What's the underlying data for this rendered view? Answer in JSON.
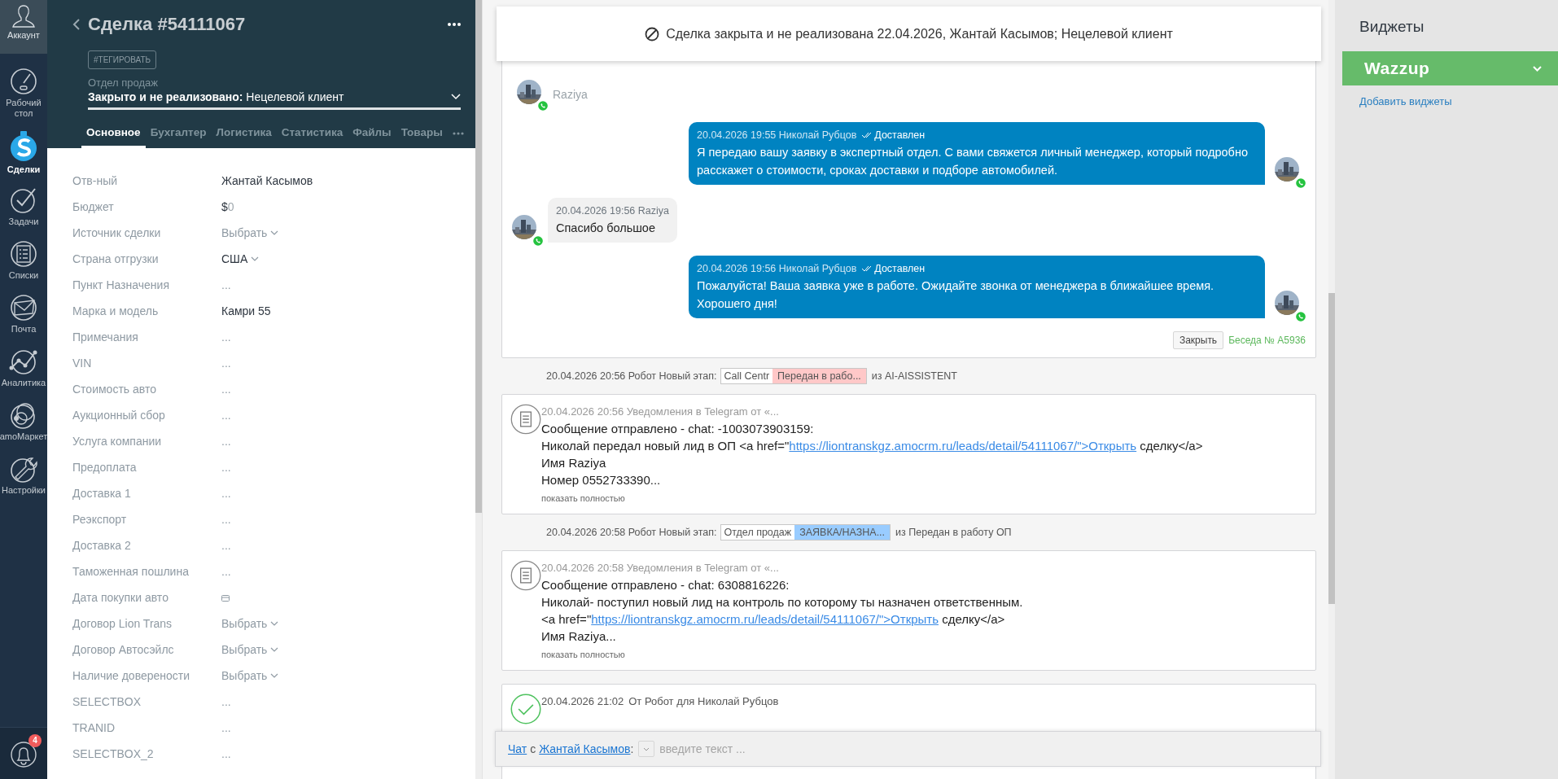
{
  "nav": {
    "account": "Аккаунт",
    "items": [
      {
        "label": "Рабочий стол",
        "kind": "dashboard",
        "selected": false
      },
      {
        "label": "Сделки",
        "kind": "deals",
        "selected": true
      },
      {
        "label": "Задачи",
        "kind": "tasks",
        "selected": false
      },
      {
        "label": "Списки",
        "kind": "lists",
        "selected": false
      },
      {
        "label": "Почта",
        "kind": "mail",
        "selected": false
      },
      {
        "label": "Аналитика",
        "kind": "analytics",
        "selected": false
      },
      {
        "label": "amoМаркет",
        "kind": "market",
        "selected": false
      },
      {
        "label": "Настройки",
        "kind": "settings",
        "selected": false
      }
    ],
    "notifications_badge": "4"
  },
  "lead": {
    "title": "Сделка #54111067",
    "tag_button": "#ТЕГИРОВАТЬ",
    "pipeline": "Отдел продаж",
    "status_bold": "Закрыто и не реализовано:",
    "status": "Нецелевой клиент",
    "tabs": [
      {
        "label": "Основное",
        "selected": true
      },
      {
        "label": "Бухгалтер",
        "selected": false
      },
      {
        "label": "Логистика",
        "selected": false
      },
      {
        "label": "Статистика",
        "selected": false
      },
      {
        "label": "Файлы",
        "selected": false
      },
      {
        "label": "Товары",
        "selected": false
      }
    ],
    "fields": [
      {
        "label": "Отв-ный",
        "kind": "text",
        "value": "Жантай Касымов"
      },
      {
        "label": "Бюджет",
        "kind": "money",
        "currency": "$",
        "value": "0"
      },
      {
        "label": "Источник сделки",
        "kind": "select",
        "placeholder": "Выбрать"
      },
      {
        "label": "Страна отгрузки",
        "kind": "select_filled",
        "value": "США"
      },
      {
        "label": "Пункт Назначения",
        "kind": "empty",
        "placeholder": "..."
      },
      {
        "label": "Марка и модель",
        "kind": "text",
        "value": "Камри 55"
      },
      {
        "label": "Примечания",
        "kind": "empty",
        "placeholder": "..."
      },
      {
        "label": "VIN",
        "kind": "empty",
        "placeholder": "..."
      },
      {
        "label": "Стоимость авто",
        "kind": "empty",
        "placeholder": "..."
      },
      {
        "label": "Аукционный сбор",
        "kind": "empty",
        "placeholder": "..."
      },
      {
        "label": "Услуга компании",
        "kind": "empty",
        "placeholder": "..."
      },
      {
        "label": "Предоплата",
        "kind": "empty",
        "placeholder": "..."
      },
      {
        "label": "Доставка 1",
        "kind": "empty",
        "placeholder": "..."
      },
      {
        "label": "Реэкспорт",
        "kind": "empty",
        "placeholder": "..."
      },
      {
        "label": "Доставка 2",
        "kind": "empty",
        "placeholder": "..."
      },
      {
        "label": "Таможенная пошлина",
        "kind": "empty",
        "placeholder": "..."
      },
      {
        "label": "Дата покупки авто",
        "kind": "date"
      },
      {
        "label": "Договор Lion Trans",
        "kind": "select",
        "placeholder": "Выбрать"
      },
      {
        "label": "Договор Автосэйлс",
        "kind": "select",
        "placeholder": "Выбрать"
      },
      {
        "label": "Наличие доверености",
        "kind": "select",
        "placeholder": "Выбрать"
      },
      {
        "label": "SELECTBOX",
        "kind": "empty",
        "placeholder": "..."
      },
      {
        "label": "TRANID",
        "kind": "empty",
        "placeholder": "..."
      },
      {
        "label": "SELECTBOX_2",
        "kind": "empty",
        "placeholder": "..."
      }
    ]
  },
  "closed_banner": "Сделка закрыта и не реализована 22.04.2026, Жантай Касымов; Нецелевой клиент",
  "chat": {
    "contact": "Raziya",
    "messages": [
      {
        "kind": "outgoing",
        "meta": "20.04.2026 19:55 Николай Рубцов",
        "status": "Доставлен",
        "text": "Я передаю вашу заявку в экспертный отдел. С вами свяжется личный менеджер, который подробно расскажет о стоимости, сроках доставки и подборе автомобилей."
      },
      {
        "kind": "incoming",
        "meta": "20.04.2026 19:56 Raziya",
        "text": "Спасибо большое"
      },
      {
        "kind": "outgoing",
        "meta": "20.04.2026 19:56 Николай Рубцов",
        "status": "Доставлен",
        "text": "Пожалуйста! Ваша заявка уже в работе. Ожидайте звонка от менеджера в ближайшее время. Хорошего дня!"
      }
    ],
    "close_button": "Закрыть",
    "conversation": "Беседа № A5936"
  },
  "feed": [
    {
      "kind": "stage",
      "text": "20.04.2026 20:56 Робот Новый этап:",
      "pipeline": "Call Centr",
      "stage": "Передан в рабо...",
      "color": "#ffc8c8",
      "from": "из AI-AISSISTENT"
    },
    {
      "kind": "note",
      "header": "20.04.2026 20:56 Уведомления в Telegram от «...",
      "lines": [
        {
          "text": "Сообщение отправлено - chat: -1003073903159:"
        },
        {
          "text": "Николай передал новый лид в ОП <a href=\"",
          "link": "https://liontranskgz.amocrm.ru/leads/detail/54111067/\">Открыть",
          "after": " сделку</a>"
        },
        {
          "text": "Имя Raziya"
        },
        {
          "text": "Номер 0552733390..."
        }
      ],
      "more": "показать полностью"
    },
    {
      "kind": "stage",
      "text": "20.04.2026 20:58 Робот Новый этап:",
      "pipeline": "Отдел продаж",
      "stage": "ЗАЯВКА/НАЗНА...",
      "color": "#99ccff",
      "from": "из Передан в работу ОП"
    },
    {
      "kind": "note",
      "header": "20.04.2026 20:58 Уведомления в Telegram от «...",
      "lines": [
        {
          "text": "Сообщение отправлено - chat: 6308816226:"
        },
        {
          "text": "Николай- поступил новый лид на контроль по которому ты назначен ответственным."
        },
        {
          "text": "<a href=\"",
          "link": "https://liontranskgz.amocrm.ru/leads/detail/54111067/\">Открыть",
          "after": " сделку</a>"
        },
        {
          "text": "Имя Raziya..."
        }
      ],
      "more": "показать полностью"
    },
    {
      "kind": "task",
      "time": "20.04.2026 21:02",
      "header": "От Робот для Николай Рубцов"
    }
  ],
  "chat_input": {
    "chat_link": "Чат",
    "with": "с",
    "contact_link": "Жантай Касымов",
    "colon": ":",
    "placeholder": "введите текст ..."
  },
  "widgets": {
    "title": "Виджеты",
    "items": [
      {
        "name": "Wazzup"
      }
    ],
    "add_link": "Добавить виджеты"
  }
}
